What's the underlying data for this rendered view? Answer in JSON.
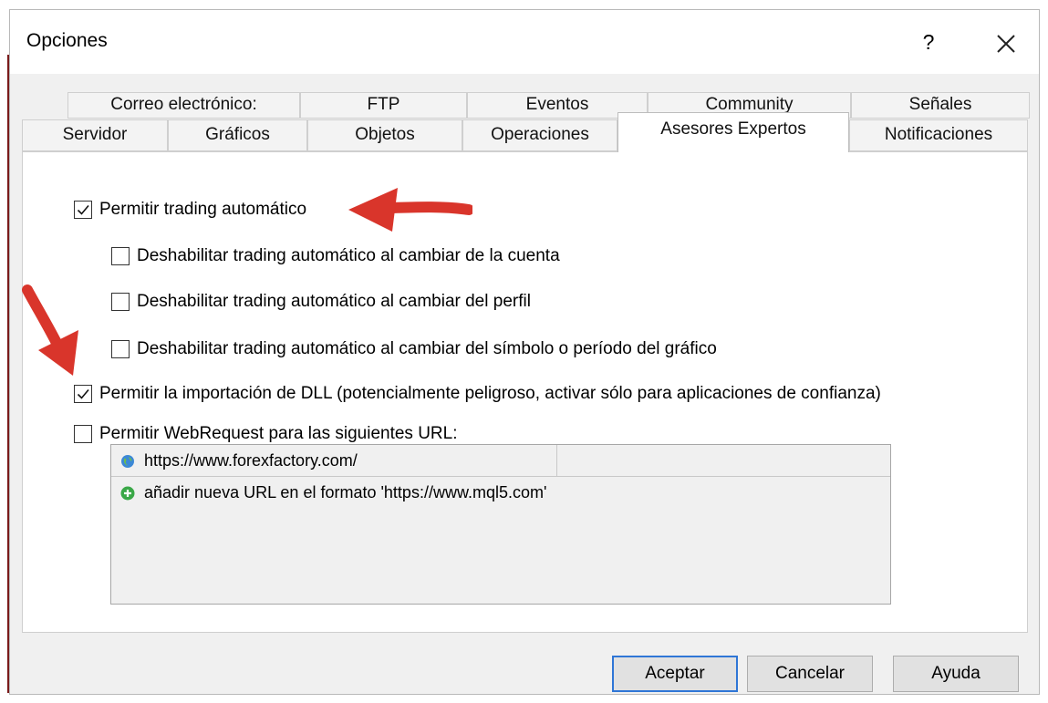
{
  "window": {
    "title": "Opciones",
    "help_label": "?",
    "close_icon": "close-icon"
  },
  "tabs": {
    "row1": [
      "Correo electrónico:",
      "FTP",
      "Eventos",
      "Community",
      "Señales"
    ],
    "row2": [
      "Servidor",
      "Gráficos",
      "Objetos",
      "Operaciones",
      "Asesores Expertos",
      "Notificaciones"
    ],
    "active": "Asesores Expertos"
  },
  "options": [
    {
      "label": "Permitir trading automático",
      "checked": true
    },
    {
      "label": "Deshabilitar trading automático al cambiar de la cuenta",
      "checked": false
    },
    {
      "label": "Deshabilitar trading automático al cambiar del perfil",
      "checked": false
    },
    {
      "label": "Deshabilitar trading automático al cambiar del símbolo o período del gráfico",
      "checked": false
    },
    {
      "label": "Permitir la importación de DLL (potencialmente peligroso, activar sólo para aplicaciones de confianza)",
      "checked": true
    },
    {
      "label": "Permitir WebRequest para las siguientes URL:",
      "checked": false
    }
  ],
  "url_list": {
    "items": [
      "https://www.forexfactory.com/"
    ],
    "add_hint": "añadir nueva URL en el formato 'https://www.mql5.com'"
  },
  "buttons": {
    "ok": "Aceptar",
    "cancel": "Cancelar",
    "help": "Ayuda"
  },
  "colors": {
    "accent": "#2f76d6",
    "arrow": "#d9352b"
  }
}
